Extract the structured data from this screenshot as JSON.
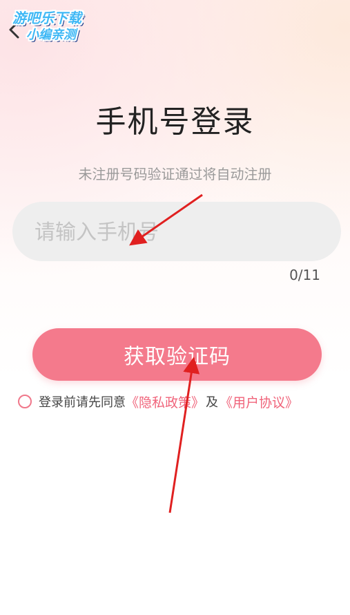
{
  "watermark": {
    "line1": "游吧乐下载",
    "line2": "小编亲测"
  },
  "page": {
    "title": "手机号登录",
    "subtitle": "未注册号码验证通过将自动注册"
  },
  "phone_input": {
    "placeholder": "请输入手机号",
    "value": "",
    "counter": "0/11"
  },
  "get_code_button": {
    "label": "获取验证码"
  },
  "agreement": {
    "prefix": "登录前请先同意",
    "privacy_policy": "《隐私政策》",
    "conjunction": "及",
    "user_agreement": "《用户协议》"
  },
  "colors": {
    "accent": "#f47a8c",
    "link": "#f0637a",
    "annotation_arrow": "#e02020"
  },
  "icons": {
    "back": "chevron-left-icon"
  }
}
